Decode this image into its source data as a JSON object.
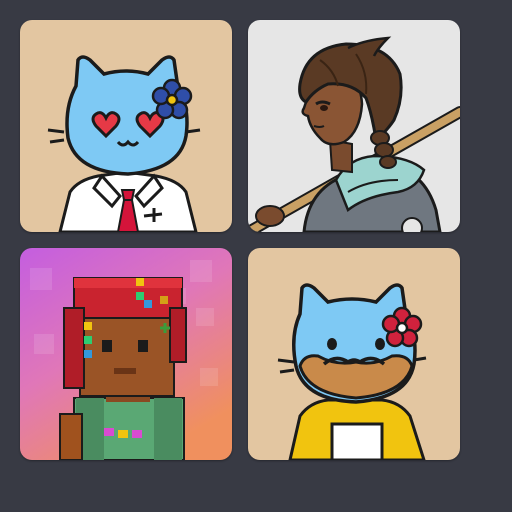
{
  "gallery": {
    "items": [
      {
        "kind": "blue-cat-heart-eyes-tie",
        "background": "#e3c6a1"
      },
      {
        "kind": "anime-girl-with-staff",
        "background": "#e6e6e6"
      },
      {
        "kind": "voxel-character-red-hair",
        "background": "#d36fd6"
      },
      {
        "kind": "blue-cat-mustache-yellow-shirt",
        "background": "#e3c6a1"
      }
    ]
  },
  "colors": {
    "page_background": "#383a44",
    "cat_blue": "#7ec9f4",
    "outline": "#1b1b1b",
    "heart_red": "#e63946",
    "tie_red": "#d4143a",
    "flower_blue": "#2f4ea8",
    "flower_red": "#d0223d",
    "shirt_yellow": "#f1c40f"
  }
}
